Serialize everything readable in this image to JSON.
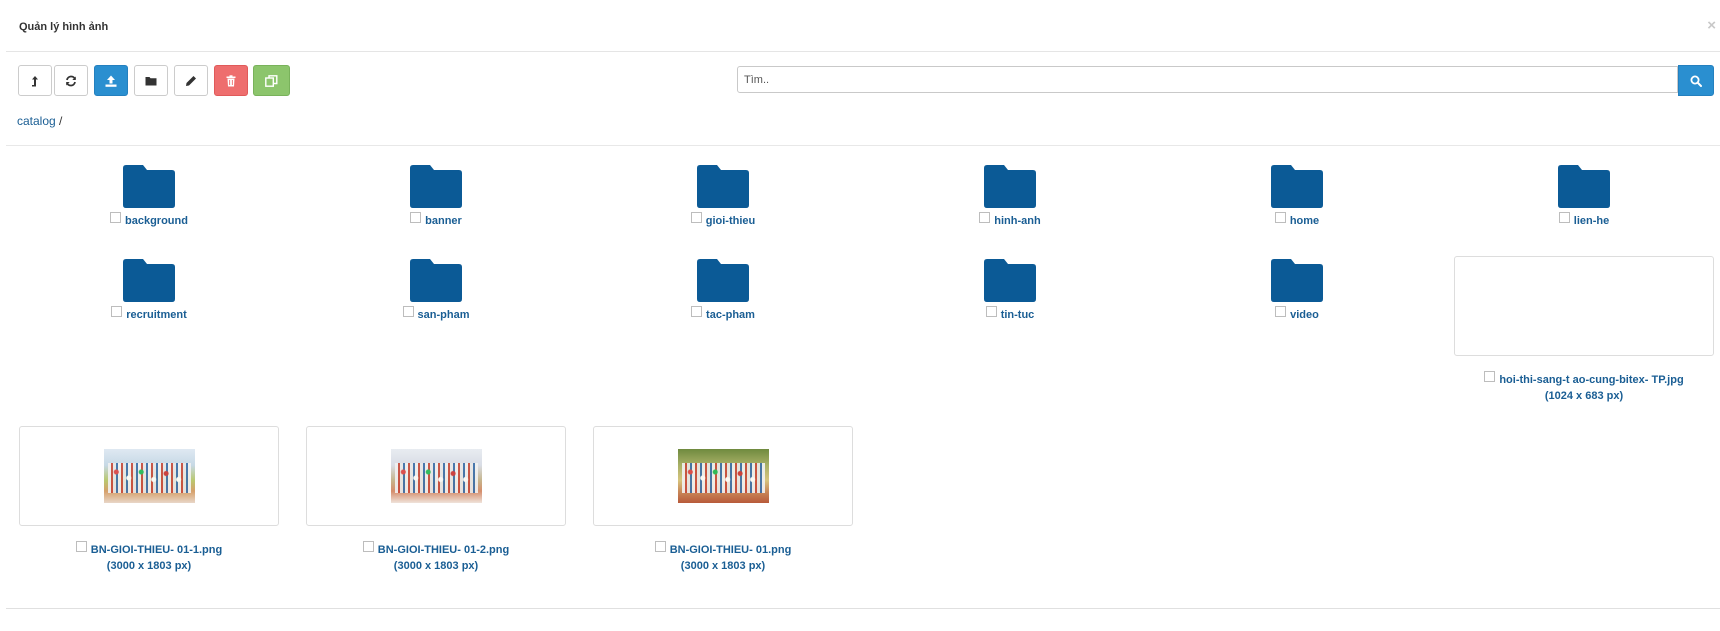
{
  "modal": {
    "title": "Quản lý hình ảnh",
    "close_label": "×"
  },
  "toolbar": {
    "buttons": [
      {
        "name": "parent-button",
        "icon": "level-up-icon"
      },
      {
        "name": "refresh-button",
        "icon": "refresh-icon"
      },
      {
        "name": "upload-button",
        "icon": "upload-icon",
        "color": "#2a8fd0"
      },
      {
        "name": "new-folder-button",
        "icon": "folder-icon"
      },
      {
        "name": "rename-button",
        "icon": "pencil-icon"
      },
      {
        "name": "delete-button",
        "icon": "trash-icon",
        "color": "#ee6e6e"
      },
      {
        "name": "copy-button",
        "icon": "copy-icon",
        "color": "#8cc56c"
      }
    ]
  },
  "search": {
    "placeholder": "Tìm..",
    "value": "",
    "button_icon": "search-icon"
  },
  "breadcrumb": {
    "root": "catalog",
    "separator": " /"
  },
  "folders": [
    {
      "name": "background"
    },
    {
      "name": "banner"
    },
    {
      "name": "gioi-thieu"
    },
    {
      "name": "hinh-anh"
    },
    {
      "name": "home"
    },
    {
      "name": "lien-he"
    },
    {
      "name": "recruitment"
    },
    {
      "name": "san-pham"
    },
    {
      "name": "tac-pham"
    },
    {
      "name": "tin-tuc"
    },
    {
      "name": "video"
    }
  ],
  "files": [
    {
      "name": "hoi-thi-sang-t ao-cung-bitex- TP.jpg",
      "dims": "(1024 x 683 px)",
      "thumbnail": "blank"
    },
    {
      "name": "BN-GIOI-THIEU- 01-1.png",
      "dims": "(3000 x 1803 px)",
      "thumbnail": "group-photo"
    },
    {
      "name": "BN-GIOI-THIEU- 01-2.png",
      "dims": "(3000 x 1803 px)",
      "thumbnail": "group-photo"
    },
    {
      "name": "BN-GIOI-THIEU- 01.png",
      "dims": "(3000 x 1803 px)",
      "thumbnail": "group-photo"
    }
  ],
  "colors": {
    "folder": "#0b5a96",
    "link": "#1a5e94",
    "primary": "#2a8fd0"
  }
}
